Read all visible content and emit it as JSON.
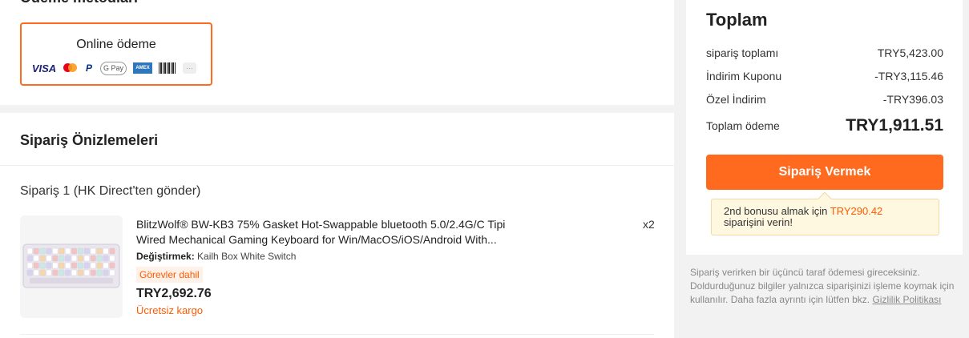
{
  "payment": {
    "title": "Ödeme metodları",
    "online_label": "Online ödeme",
    "logos": {
      "visa": "VISA",
      "mastercard": "mastercard-icon",
      "paypal": "P",
      "gpay": "G Pay",
      "amex": "AMEX",
      "barcode": "barcode-icon",
      "more": "···"
    },
    "accent": "#ff6a1e"
  },
  "preview": {
    "title": "Sipariş Önizlemeleri",
    "order_header": "Sipariş 1 (HK Direct'ten gönder)",
    "product": {
      "title": "BlitzWolf® BW-KB3 75% Gasket Hot-Swappable bluetooth 5.0/2.4G/C Tipi Wired Mechanical Gaming Keyboard for Win/MacOS/iOS/Android With...",
      "qty": "x2",
      "variant_label": "Değiştirmek:",
      "variant_value": "Kailh Box White Switch",
      "badge": "Görevler dahil",
      "price": "TRY2,692.76",
      "shipping": "Ücretsiz kargo"
    }
  },
  "total": {
    "title": "Toplam",
    "rows": [
      {
        "label": "sipariş toplamı",
        "value": "TRY5,423.00"
      },
      {
        "label": "İndirim Kuponu",
        "value": "-TRY3,115.46"
      },
      {
        "label": "Özel İndirim",
        "value": "-TRY396.03"
      }
    ],
    "grand_label": "Toplam ödeme",
    "grand_value": "TRY1,911.51",
    "button_label": "Sipariş Vermek",
    "bonus_prefix": "2nd bonusu almak için",
    "bonus_amount": "TRY290.42",
    "bonus_suffix": "siparişini verin!"
  },
  "disclaimer": {
    "text": "Sipariş verirken bir üçüncü taraf ödemesi gireceksiniz. Doldurduğunuz bilgiler yalnızca siparişinizi işleme koymak için kullanılır. Daha fazla ayrıntı için lütfen bkz.",
    "link": "Gizlilik Politikası"
  }
}
